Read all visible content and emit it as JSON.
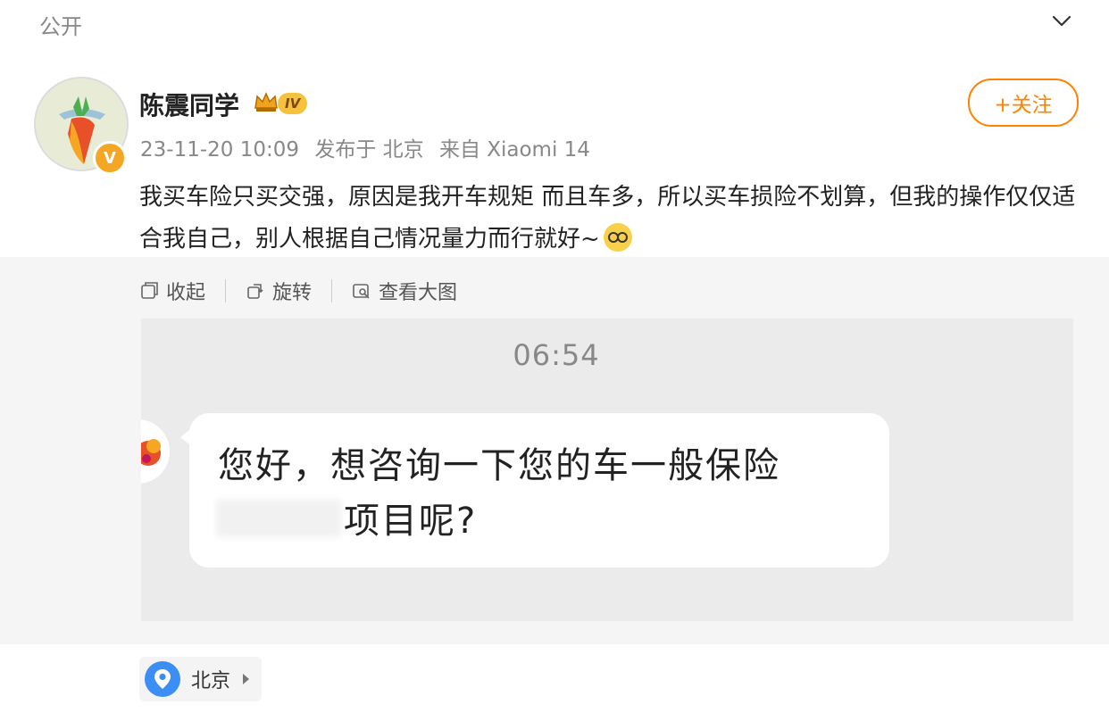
{
  "header": {
    "visibility": "公开",
    "collapse_icon": "chevron-down-icon"
  },
  "post": {
    "username": "陈震同学",
    "level_badge": "IV",
    "date": "23-11-20 10:09",
    "posted_from": "发布于 北京",
    "source": "来自 Xiaomi 14",
    "follow_label": "+关注",
    "text": "我买车险只买交强，原因是我开车规矩 而且车多，所以买车损险不划算，但我的操作仅仅适合我自己，别人根据自己情况量力而行就好~",
    "accent_color": "#ff8200"
  },
  "image_toolbar": {
    "collapse_label": "收起",
    "rotate_label": "旋转",
    "view_large_label": "查看大图"
  },
  "chat_screenshot": {
    "time": "06:54",
    "message_line1": "您好，想咨询一下您的车一般保险",
    "message_line2": "项目呢?"
  },
  "location": {
    "label": "北京",
    "icon": "location-pin-icon"
  }
}
